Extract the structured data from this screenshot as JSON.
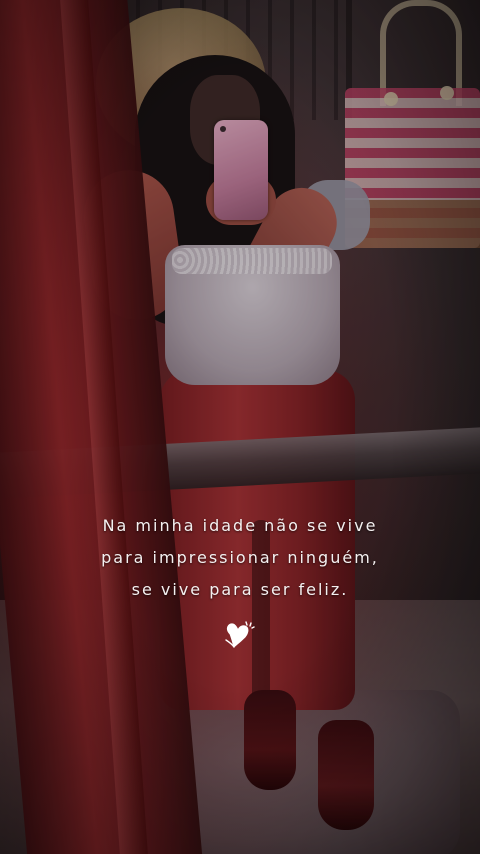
{
  "caption": {
    "lines": [
      "Na minha idade não se vive",
      "para impressionar ninguém,",
      "se vive para ser feliz."
    ]
  },
  "sticker": {
    "icon": "heart-icon",
    "color": "#ffffff"
  },
  "colors": {
    "caption_text": "#f4f0f0",
    "accent_red": "#a22a2e"
  }
}
